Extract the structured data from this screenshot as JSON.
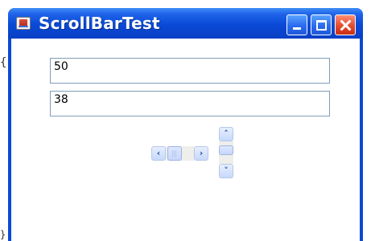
{
  "window": {
    "title": "ScrollBarTest"
  },
  "fields": [
    {
      "value": "50"
    },
    {
      "value": "38"
    }
  ],
  "icons": {
    "app": "java-app-icon",
    "minimize": "minimize-icon",
    "maximize": "maximize-icon",
    "close": "close-icon",
    "arrow_left": "‹",
    "arrow_right": "›",
    "arrow_up": "˄",
    "arrow_down": "˅"
  },
  "colors": {
    "titlebar": "#0a49d6",
    "field_border": "#7f9db9"
  }
}
